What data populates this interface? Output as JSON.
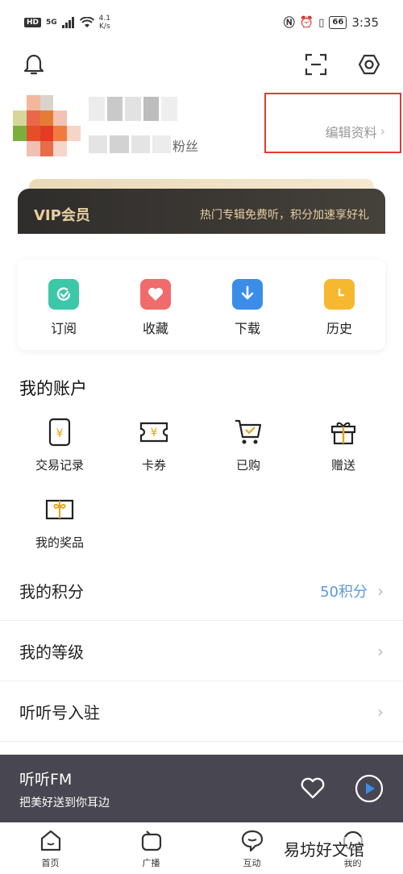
{
  "status_bar": {
    "hd": "HD",
    "signal": "5G",
    "speed_value": "4.1",
    "speed_unit": "K/s",
    "battery": "66",
    "time": "3:35"
  },
  "header": {
    "bell_icon": "bell-icon",
    "scan_icon": "scan-icon",
    "settings_icon": "gear-icon"
  },
  "profile": {
    "fans_label": "粉丝",
    "edit_label": "编辑资料"
  },
  "vip": {
    "title": "VIP会员",
    "desc": "热门专辑免费听，积分加速享好礼"
  },
  "quick_actions": [
    {
      "label": "订阅",
      "color": "#3cc8a8",
      "icon": "subscribe-icon"
    },
    {
      "label": "收藏",
      "color": "#f06b6b",
      "icon": "heart-icon"
    },
    {
      "label": "下载",
      "color": "#3b8de8",
      "icon": "download-icon"
    },
    {
      "label": "历史",
      "color": "#f5b82e",
      "icon": "clock-icon"
    }
  ],
  "account": {
    "title": "我的账户",
    "items": [
      {
        "label": "交易记录",
        "icon": "receipt-icon"
      },
      {
        "label": "卡券",
        "icon": "ticket-icon"
      },
      {
        "label": "已购",
        "icon": "cart-icon"
      },
      {
        "label": "赠送",
        "icon": "gift-icon"
      },
      {
        "label": "我的奖品",
        "icon": "prize-icon"
      }
    ]
  },
  "rows": {
    "points": {
      "title": "我的积分",
      "value": "50积分"
    },
    "level": {
      "title": "我的等级"
    },
    "join": {
      "title": "听听号入驻"
    }
  },
  "player": {
    "title": "听听FM",
    "subtitle": "把美好送到你耳边"
  },
  "nav": [
    {
      "label": "首页",
      "icon": "home-icon"
    },
    {
      "label": "广播",
      "icon": "radio-icon"
    },
    {
      "label": "互动",
      "icon": "chat-icon"
    },
    {
      "label": "我的",
      "icon": "profile-icon"
    }
  ],
  "watermark": "易坊好文馆",
  "colors": {
    "accent_gold": "#e8cf9f",
    "link_blue": "#5b9bd5",
    "highlight_red": "#e53935",
    "player_bg": "#474651"
  }
}
